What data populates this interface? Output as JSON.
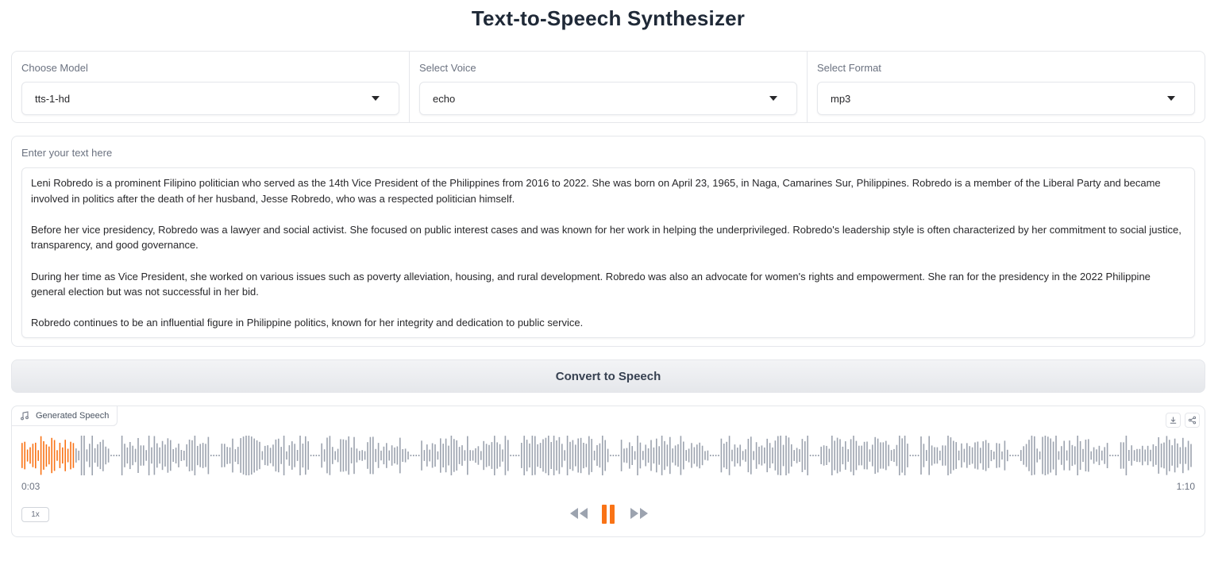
{
  "page": {
    "title": "Text-to-Speech Synthesizer"
  },
  "model": {
    "label": "Choose Model",
    "value": "tts-1-hd"
  },
  "voice": {
    "label": "Select Voice",
    "value": "echo"
  },
  "format": {
    "label": "Select Format",
    "value": "mp3"
  },
  "text_input": {
    "label": "Enter your text here",
    "paragraphs": [
      "Leni Robredo is a prominent Filipino politician who served as the 14th Vice President of the Philippines from 2016 to 2022. She was born on April 23, 1965, in Naga, Camarines Sur, Philippines. Robredo is a member of the Liberal Party and became involved in politics after the death of her husband, Jesse Robredo, who was a respected politician himself.",
      "Before her vice presidency, Robredo was a lawyer and social activist. She focused on public interest cases and was known for her work in helping the underprivileged. Robredo's leadership style is often characterized by her commitment to social justice, transparency, and good governance.",
      "During her time as Vice President, she worked on various issues such as poverty alleviation, housing, and rural development. Robredo was also an advocate for women's rights and empowerment. She ran for the presidency in the 2022 Philippine general election but was not successful in her bid.",
      "Robredo continues to be an influential figure in Philippine politics, known for her integrity and dedication to public service."
    ]
  },
  "convert_button": {
    "label": "Convert to Speech"
  },
  "audio": {
    "label": "Generated Speech",
    "current_time": "0:03",
    "duration": "1:10",
    "speed": "1x",
    "progress": 0.045,
    "colors": {
      "played": "#f97316",
      "unplayed": "#9ca3af",
      "pause": "#f97316",
      "skip": "#9ca3af"
    },
    "icons": [
      "music-note-icon",
      "download-icon",
      "share-icon",
      "rewind-icon",
      "pause-icon",
      "fast-forward-icon"
    ]
  }
}
